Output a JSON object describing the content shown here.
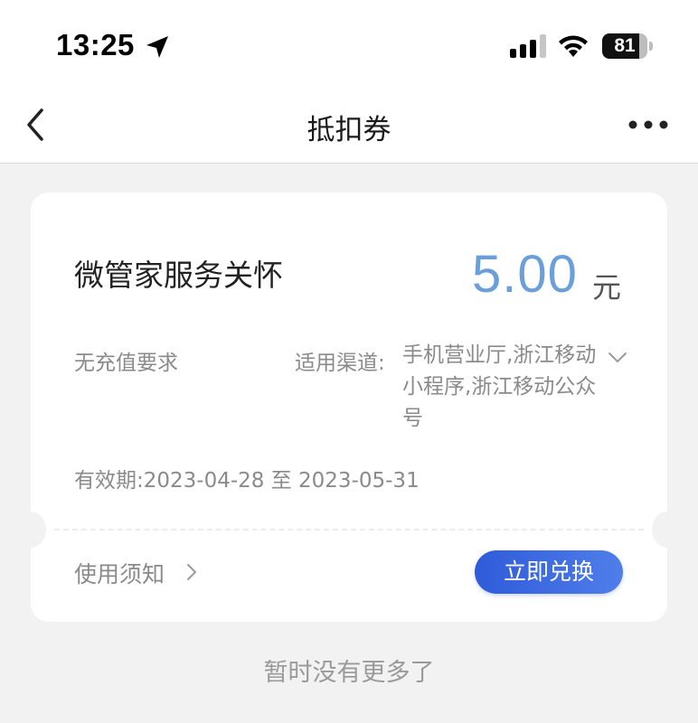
{
  "status_bar": {
    "time": "13:25",
    "battery": "81",
    "battery_level": 0.81,
    "icons": [
      "location-arrow-icon",
      "signal-icon",
      "wifi-icon",
      "battery-icon"
    ]
  },
  "nav": {
    "title": "抵扣券",
    "back_icon": "chevron-left-icon",
    "more_icon": "more-dots-icon"
  },
  "coupon": {
    "name": "微管家服务关怀",
    "amount": "5.00",
    "unit": "元",
    "requirement": "无充值要求",
    "channel_label": "适用渠道:",
    "channel_value": "手机营业厅,浙江移动小程序,浙江移动公众号",
    "validity": "有效期:2023-04-28 至 2023-05-31",
    "notice_label": "使用须知",
    "redeem_label": "立即兑换"
  },
  "footer": {
    "note": "暂时没有更多了"
  },
  "colors": {
    "amount": "#6a9fd9",
    "button": "#2f5bd9",
    "background": "#f2f2f2"
  }
}
